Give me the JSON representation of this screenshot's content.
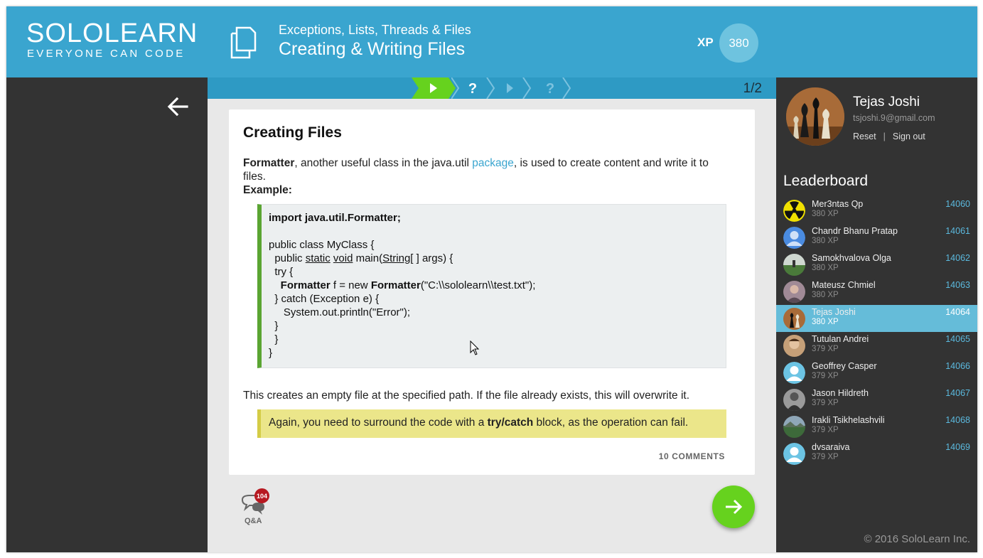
{
  "brand": {
    "name": "SOLOLEARN",
    "tagline": "EVERYONE CAN CODE"
  },
  "header": {
    "course": "Exceptions, Lists, Threads & Files",
    "lesson_title": "Creating & Writing Files",
    "xp_label": "XP",
    "xp_value": "380",
    "icon": "file-copy-icon"
  },
  "progress": {
    "steps": [
      {
        "icon": "play-icon",
        "state": "active"
      },
      {
        "icon": "question-icon",
        "state": "done"
      },
      {
        "icon": "play-icon",
        "state": "pending"
      },
      {
        "icon": "question-icon",
        "state": "pending"
      }
    ],
    "count": "1/2"
  },
  "lesson": {
    "title": "Creating Files",
    "intro_bold": "Formatter",
    "intro_1": ", another useful class in the java.util ",
    "intro_link": "package",
    "intro_2": ", is used to create content and write it to",
    "intro_3": "files.",
    "example_label": "Example:",
    "code": {
      "l1": "import java.util.Formatter;",
      "l3": "public class MyClass {",
      "l4_a": "  public ",
      "l4_static": "static",
      "l4_b": " ",
      "l4_void": "void",
      "l4_c": " main(",
      "l4_string": "String",
      "l4_d": "[ ] args) {",
      "l5": "  try {",
      "l6_indent": "    ",
      "l6_a": "Formatter",
      "l6_b": " f = new ",
      "l6_c": "Formatter",
      "l6_d": "(\"C:\\\\sololearn\\\\test.txt\");",
      "l7": "  } catch (Exception e) {",
      "l8": "     System.out.println(\"Error\");",
      "l9": "  }",
      "l10": "  }",
      "l11": "}"
    },
    "after_code": "This creates an empty file at the specified path. If the file already exists, this will overwrite it.",
    "note_1": "Again, you need to surround the code with a ",
    "note_bold": "try/catch",
    "note_2": " block, as the operation can fail.",
    "comments": "10 COMMENTS"
  },
  "qa": {
    "label": "Q&A",
    "badge": "104"
  },
  "profile": {
    "name": "Tejas Joshi",
    "email": "tsjoshi.9@gmail.com",
    "reset": "Reset",
    "separator": "|",
    "signout": "Sign out"
  },
  "leaderboard": {
    "title": "Leaderboard",
    "rows": [
      {
        "name": "Mer3ntas Qp",
        "xp": "380 XP",
        "rank": "14060",
        "avatar": "radiation-icon"
      },
      {
        "name": "Chandr Bhanu Pratap",
        "xp": "380 XP",
        "rank": "14061",
        "avatar": "default-user-icon"
      },
      {
        "name": "Samokhvalova Olga",
        "xp": "380 XP",
        "rank": "14062",
        "avatar": "photo-field"
      },
      {
        "name": "Mateusz Chmiel",
        "xp": "380 XP",
        "rank": "14063",
        "avatar": "photo-person"
      },
      {
        "name": "Tejas Joshi",
        "xp": "380 XP",
        "rank": "14064",
        "avatar": "photo-chess"
      },
      {
        "name": "Tutulan Andrei",
        "xp": "379 XP",
        "rank": "14065",
        "avatar": "photo-person"
      },
      {
        "name": "Geoffrey Casper",
        "xp": "379 XP",
        "rank": "14066",
        "avatar": "default-user-icon"
      },
      {
        "name": "Jason Hildreth",
        "xp": "379 XP",
        "rank": "14067",
        "avatar": "photo-person"
      },
      {
        "name": "Irakli Tsikhelashvili",
        "xp": "379 XP",
        "rank": "14068",
        "avatar": "photo-landscape"
      },
      {
        "name": "dvsaraiva",
        "xp": "379 XP",
        "rank": "14069",
        "avatar": "default-user-icon"
      }
    ]
  },
  "footer": {
    "copyright": "© 2016 SoloLearn Inc."
  },
  "colors": {
    "header": "#3aa5cf",
    "sidebar": "#333333",
    "active_step": "#66d21e",
    "code_border": "#5aa532",
    "note_bg": "#ebe68a",
    "highlight_row": "#65bcd9"
  }
}
